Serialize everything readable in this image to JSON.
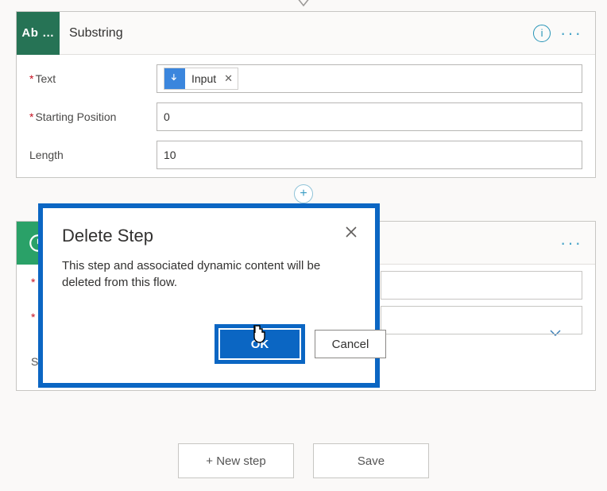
{
  "substring": {
    "brand_text": "Ab …",
    "title": "Substring",
    "fields": {
      "text_label": "Text",
      "text_token": "Input",
      "starting_label": "Starting Position",
      "starting_value": "0",
      "length_label": "Length",
      "length_value": "10"
    }
  },
  "modal": {
    "title": "Delete Step",
    "message": "This step and associated dynamic content will be deleted from this flow.",
    "ok": "OK",
    "cancel": "Cancel"
  },
  "bottom": {
    "new_step": "+ New step",
    "save": "Save"
  },
  "second_card": {
    "partial_label": "S"
  }
}
